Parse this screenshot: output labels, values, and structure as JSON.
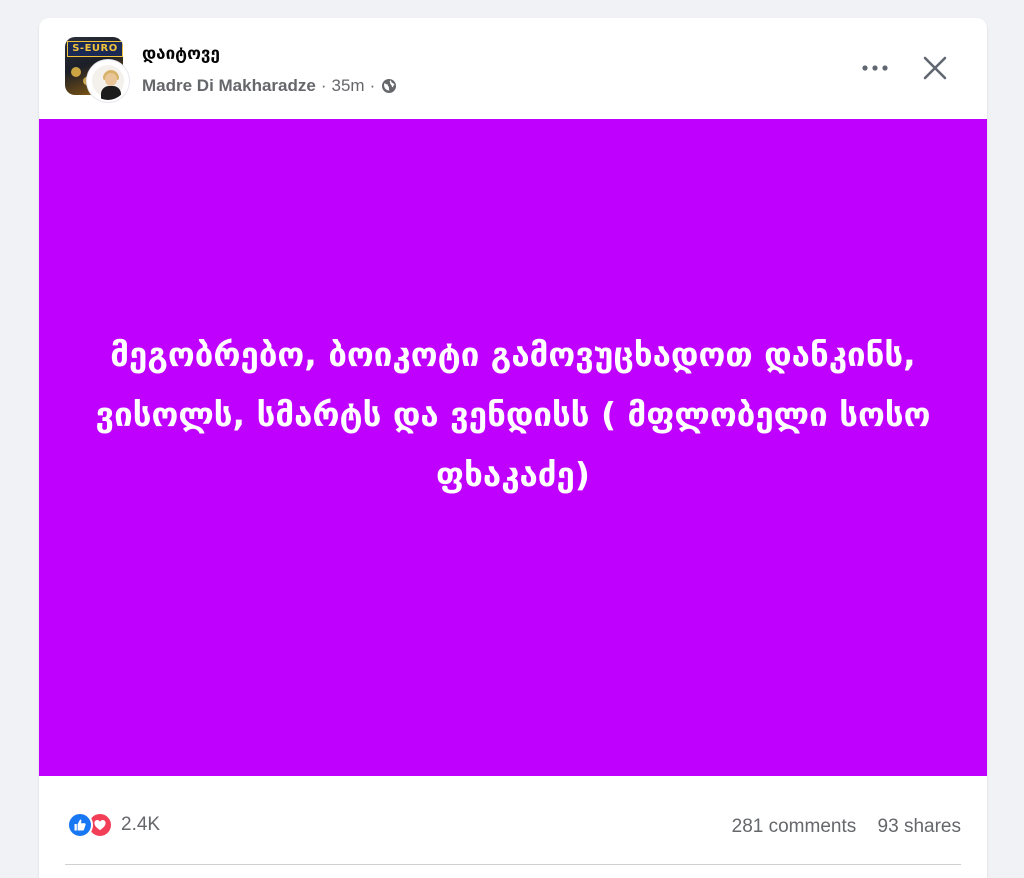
{
  "post": {
    "group_name": "დაიტოვე",
    "author": "Madre Di Makharadze",
    "separator": "·",
    "time": "35m",
    "audience_icon": "globe-icon",
    "group_avatar_sign": "S-EURO",
    "more_icon": "more-horizontal-icon",
    "close_icon": "close-icon",
    "image_background": "#c000ff",
    "image_text": "მეგობრებო, ბოიკოტი გამოვუცხადოთ დანკინს, ვისოლს, სმარტს და ვენდისს ( მფლობელი სოსო ფხაკაძე)"
  },
  "footer": {
    "reaction_icons": [
      "like-icon",
      "love-icon"
    ],
    "reaction_count": "2.4K",
    "comments": "281 comments",
    "shares": "93 shares"
  },
  "colors": {
    "like": "#1877f2",
    "love": "#f33e58",
    "secondary_text": "#65676b"
  }
}
